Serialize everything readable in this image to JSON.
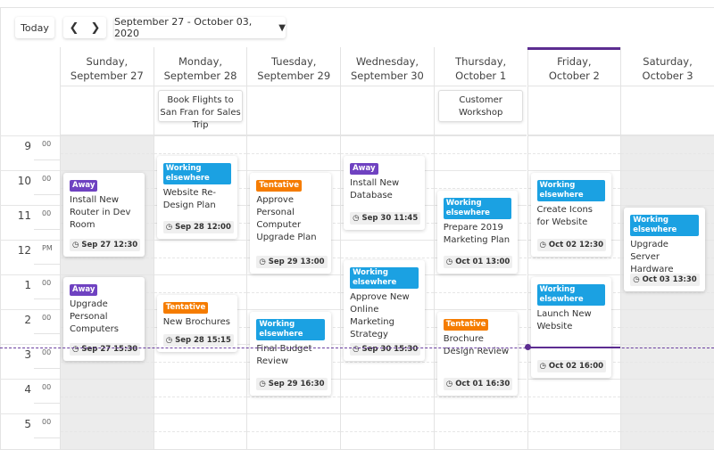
{
  "toolbar": {
    "today": "Today",
    "prev_icon": "chevron-left-icon",
    "next_icon": "chevron-right-icon",
    "date_range": "September 27 - October 03, 2020",
    "dropdown_icon": "chevron-down-icon"
  },
  "colors": {
    "accent": "#5c2d91",
    "Away": "#6f42c1",
    "Working elsewhere": "#1ba1e2",
    "Tentative": "#f57c00",
    "weekend": "#ececec"
  },
  "days": [
    {
      "name": "Sunday,",
      "date": "September 27",
      "weekend": true,
      "today": false
    },
    {
      "name": "Monday,",
      "date": "September 28",
      "weekend": false,
      "today": false
    },
    {
      "name": "Tuesday,",
      "date": "September 29",
      "weekend": false,
      "today": false
    },
    {
      "name": "Wednesday,",
      "date": "September 30",
      "weekend": false,
      "today": false
    },
    {
      "name": "Thursday,",
      "date": "October 1",
      "weekend": false,
      "today": false
    },
    {
      "name": "Friday,",
      "date": "October 2",
      "weekend": false,
      "today": true
    },
    {
      "name": "Saturday,",
      "date": "October 3",
      "weekend": true,
      "today": false
    }
  ],
  "all_day_events": [
    {
      "day": 1,
      "title": "Book Flights to San Fran for Sales Trip"
    },
    {
      "day": 4,
      "title": "Customer Workshop"
    }
  ],
  "time_labels": [
    {
      "h": "9",
      "m": "00"
    },
    {
      "h": "10",
      "m": "00"
    },
    {
      "h": "11",
      "m": "00"
    },
    {
      "h": "12",
      "m": "PM"
    },
    {
      "h": "1",
      "m": "00"
    },
    {
      "h": "2",
      "m": "00"
    },
    {
      "h": "3",
      "m": "00"
    },
    {
      "h": "4",
      "m": "00"
    },
    {
      "h": "5",
      "m": "00"
    }
  ],
  "current_time": 15.1,
  "events": [
    {
      "day": 0,
      "start": 10,
      "end": 12.5,
      "status": "Away",
      "title": "Install New Router in Dev Room",
      "time": "Sep 27 12:30"
    },
    {
      "day": 0,
      "start": 13,
      "end": 15.5,
      "status": "Away",
      "title": "Upgrade Personal Computers",
      "time": "Sep 27 15:30"
    },
    {
      "day": 1,
      "start": 9.5,
      "end": 12,
      "status": "Working elsewhere",
      "title": "Website Re-Design Plan",
      "time": "Sep 28 12:00"
    },
    {
      "day": 1,
      "start": 13.5,
      "end": 15.25,
      "status": "Tentative",
      "title": "New Brochures",
      "time": "Sep 28 15:15"
    },
    {
      "day": 2,
      "start": 10,
      "end": 13,
      "status": "Tentative",
      "title": "Approve Personal Computer Upgrade Plan",
      "time": "Sep 29 13:00"
    },
    {
      "day": 2,
      "start": 14,
      "end": 16.5,
      "status": "Working elsewhere",
      "title": "Final Budget Review",
      "time": "Sep 29 16:30"
    },
    {
      "day": 3,
      "start": 9.5,
      "end": 11.75,
      "status": "Away",
      "title": "Install New Database",
      "time": "Sep 30 11:45"
    },
    {
      "day": 3,
      "start": 12.5,
      "end": 15.5,
      "status": "Working elsewhere",
      "title": "Approve New Online Marketing Strategy",
      "time": "Sep 30 15:30"
    },
    {
      "day": 4,
      "start": 10.5,
      "end": 13,
      "status": "Working elsewhere",
      "title": "Prepare 2019 Marketing Plan",
      "time": "Oct 01 13:00"
    },
    {
      "day": 4,
      "start": 14,
      "end": 16.5,
      "status": "Tentative",
      "title": "Brochure Design Review",
      "time": "Oct 01 16:30"
    },
    {
      "day": 5,
      "start": 10,
      "end": 12.5,
      "status": "Working elsewhere",
      "title": "Create Icons for Website",
      "time": "Oct 02 12:30"
    },
    {
      "day": 5,
      "start": 13,
      "end": 16,
      "status": "Working elsewhere",
      "title": "Launch New Website",
      "time": "Oct 02 16:00"
    },
    {
      "day": 6,
      "start": 11,
      "end": 13.5,
      "status": "Working elsewhere",
      "title": "Upgrade Server Hardware",
      "time": "Oct 03 13:30"
    }
  ]
}
